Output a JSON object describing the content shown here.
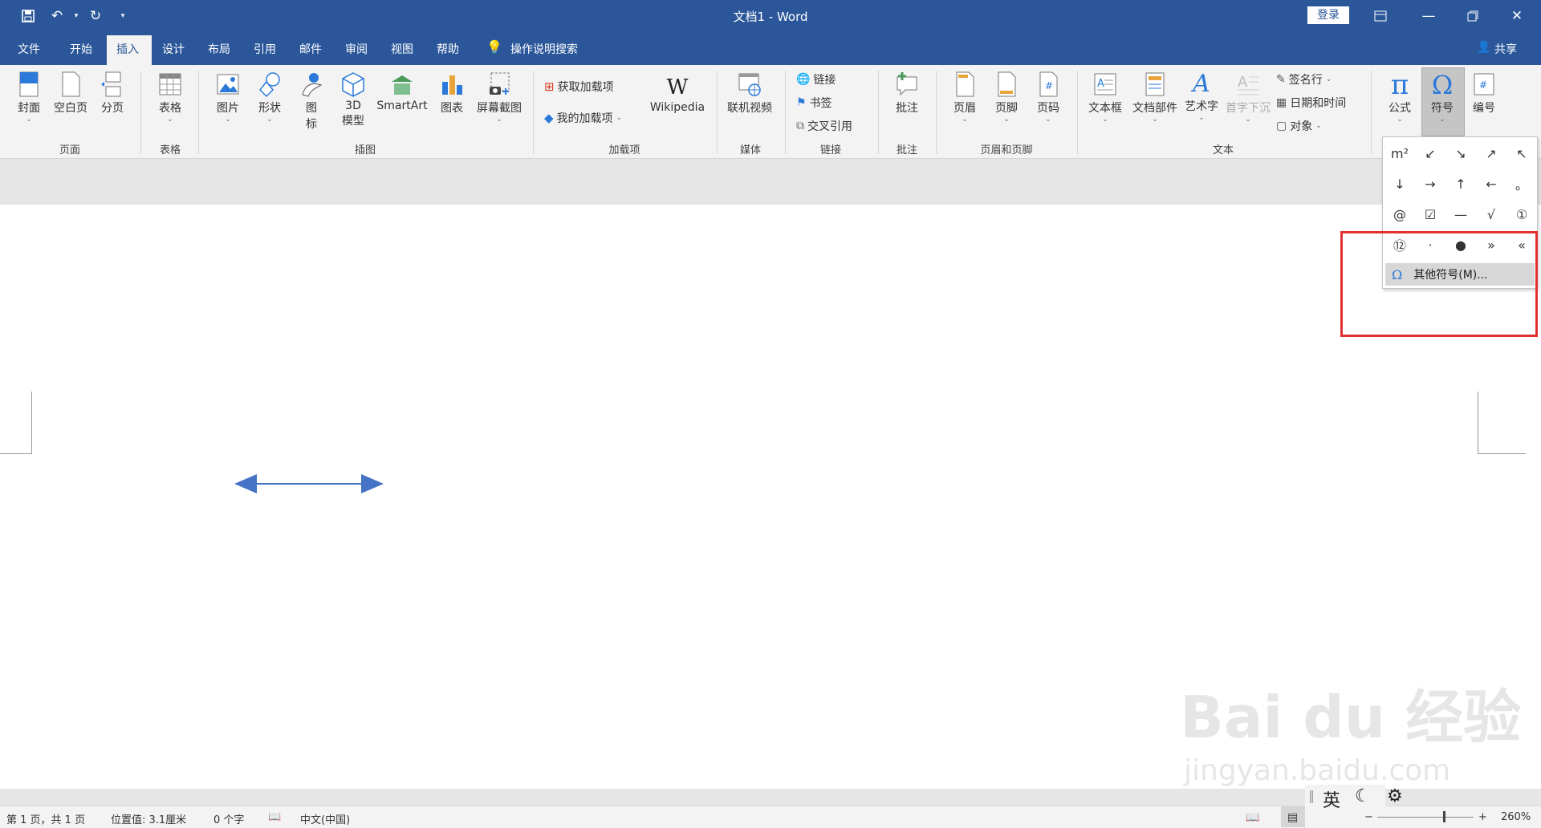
{
  "window": {
    "title": "文档1  -  Word",
    "login": "登录",
    "share": "共享"
  },
  "tabs": [
    "文件",
    "开始",
    "插入",
    "设计",
    "布局",
    "引用",
    "邮件",
    "审阅",
    "视图",
    "帮助"
  ],
  "tell_me": "操作说明搜索",
  "ribbon": {
    "groups": {
      "pages": "页面",
      "tables": "表格",
      "illustrations": "插图",
      "addins": "加载项",
      "media": "媒体",
      "links": "链接",
      "comments": "批注",
      "header_footer": "页眉和页脚",
      "text": "文本"
    },
    "buttons": {
      "cover": "封面",
      "blank_page": "空白页",
      "page_break": "分页",
      "table": "表格",
      "picture": "图片",
      "shapes": "形状",
      "icons_1": "图",
      "icons_2": "标",
      "model_1": "3D",
      "model_2": "模型",
      "smartart": "SmartArt",
      "chart": "图表",
      "screenshot": "屏幕截图",
      "get_addins": "获取加载项",
      "my_addins": "我的加载项",
      "wikipedia": "Wikipedia",
      "online_video": "联机视频",
      "link": "链接",
      "bookmark": "书签",
      "cross_ref": "交叉引用",
      "comment": "批注",
      "header": "页眉",
      "footer": "页脚",
      "page_number": "页码",
      "textbox": "文本框",
      "quick_parts": "文档部件",
      "wordart": "艺术字",
      "drop_cap": "首字下沉",
      "signature": "签名行",
      "datetime": "日期和时间",
      "object": "对象",
      "equation": "公式",
      "symbol": "符号",
      "numbering": "编号"
    }
  },
  "symbol_panel": {
    "symbols": [
      "m²",
      "↙",
      "↘",
      "↗",
      "↖",
      "↓",
      "→",
      "↑",
      "←",
      "。",
      "@",
      "☑",
      "—",
      "√",
      "①",
      "⑫",
      "·",
      "●",
      "»",
      "«"
    ],
    "more": "其他符号(M)..."
  },
  "statusbar": {
    "page": "第 1 页，共 1 页",
    "position": "位置值: 3.1厘米",
    "words": "0 个字",
    "language": "中文(中国)",
    "ime": "英",
    "zoom": "260%"
  },
  "watermark": {
    "line1": "Bai du 经验",
    "line2": "jingyan.baidu.com"
  },
  "colors": {
    "titlebar": "#2b579a",
    "arrow": "#4472c4",
    "highlight": "#e03030"
  }
}
